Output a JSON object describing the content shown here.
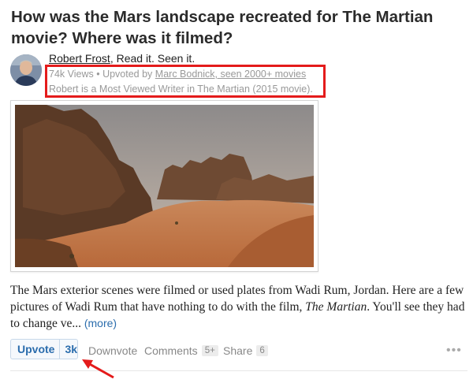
{
  "question": {
    "title": "How was the Mars landscape recreated for The Martian movie? Where was it filmed?"
  },
  "author": {
    "name": "Robert Frost",
    "credential": ", Read it. Seen it."
  },
  "meta": {
    "views": "74k Views",
    "separator": " • ",
    "upvoted_prefix": "Upvoted by ",
    "upvoter": "Marc Bodnick, seen 2000+ movies",
    "most_viewed": "Robert is a Most Viewed Writer in The Martian (2015 movie)."
  },
  "answer": {
    "text_1": "The Mars exterior scenes were filmed or used plates from Wadi Rum, Jordan.  Here are a few pictures of Wadi Rum that have nothing to do with the film, ",
    "text_italic": "The Martian",
    "text_2": ". You'll see they had to change ve... ",
    "more_label": "(more)"
  },
  "actions": {
    "upvote_label": "Upvote",
    "upvote_count": "3k",
    "downvote_label": "Downvote",
    "comments_label": "Comments",
    "comments_count": "5+",
    "share_label": "Share",
    "share_count": "6",
    "more_icon": "ellipsis-icon"
  },
  "colors": {
    "highlight_box": "#e41b1b",
    "link_blue": "#2b6dad",
    "annotation_arrow": "#e41b1b"
  }
}
